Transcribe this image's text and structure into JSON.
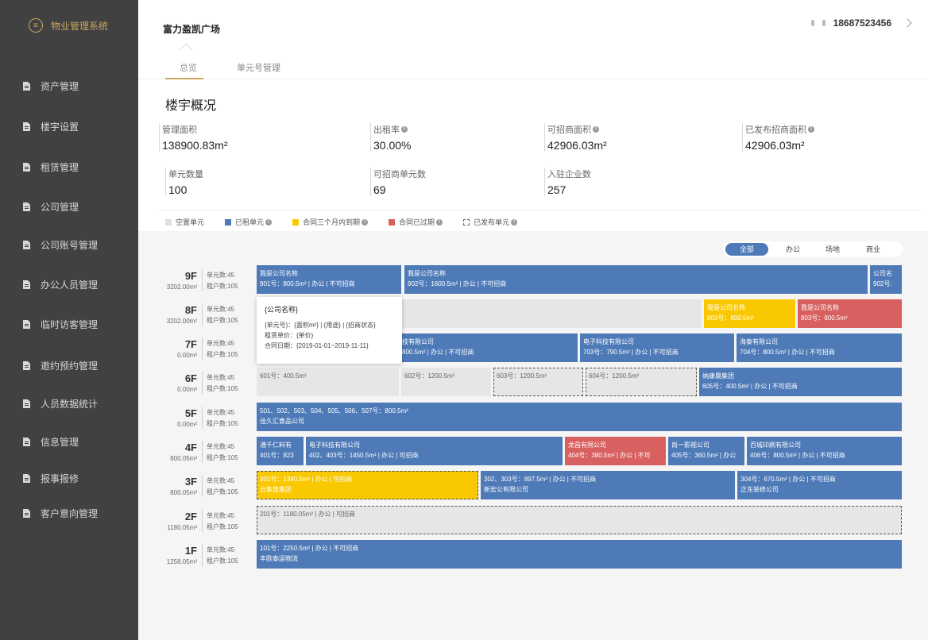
{
  "sidebar": {
    "brand": "物业管理系统",
    "items": [
      {
        "label": "资产管理"
      },
      {
        "label": "楼宇设置"
      },
      {
        "label": "租赁管理"
      },
      {
        "label": "公司管理"
      },
      {
        "label": "公司账号管理"
      },
      {
        "label": "办公人员管理"
      },
      {
        "label": "临时访客管理"
      },
      {
        "label": "邀约预约管理"
      },
      {
        "label": "人员数据统计"
      },
      {
        "label": "信息管理"
      },
      {
        "label": "报事报修"
      },
      {
        "label": "客户意向管理"
      }
    ]
  },
  "header": {
    "title": "富力盈凯广场",
    "tabs": [
      {
        "label": "总览"
      },
      {
        "label": "单元号管理"
      }
    ],
    "phone": "18687523456"
  },
  "overview": {
    "title": "楼宇概况",
    "stats": [
      {
        "label": "管理面积",
        "value": "138900.83m²",
        "info": false
      },
      {
        "label": "出租率",
        "value": "30.00%",
        "info": true
      },
      {
        "label": "可招商面积",
        "value": "42906.03m²",
        "info": true
      },
      {
        "label": "已发布招商面积",
        "value": "42906.03m²",
        "info": true
      },
      {
        "label": "单元数量",
        "value": "100",
        "info": false
      },
      {
        "label": "可招商单元数",
        "value": "69",
        "info": false
      },
      {
        "label": "入驻企业数",
        "value": "257",
        "info": false
      }
    ]
  },
  "legend": [
    {
      "label": "空置单元",
      "color": "#e0e0e0",
      "info": false
    },
    {
      "label": "已租单元",
      "color": "#4e7ab8",
      "info": true
    },
    {
      "label": "合同三个月内到期",
      "color": "#fac800",
      "info": true
    },
    {
      "label": "合同已过期",
      "color": "#d86060",
      "info": true
    },
    {
      "label": "已发布单元",
      "color": "dashed",
      "info": true
    }
  ],
  "filters": [
    {
      "label": "全部",
      "active": true
    },
    {
      "label": "办公",
      "active": false
    },
    {
      "label": "场地",
      "active": false
    },
    {
      "label": "商业",
      "active": false
    }
  ],
  "floors": [
    {
      "floor": "9F",
      "area": "3202.00m²",
      "units": "单元数:45",
      "tenants": "租户数:105"
    },
    {
      "floor": "8F",
      "area": "3202.00m²",
      "units": "单元数:45",
      "tenants": "租户数:105"
    },
    {
      "floor": "7F",
      "area": "0.00m²",
      "units": "单元数:45",
      "tenants": "租户数:105"
    },
    {
      "floor": "6F",
      "area": "0.00m²",
      "units": "单元数:45",
      "tenants": "租户数:105"
    },
    {
      "floor": "5F",
      "area": "0.00m²",
      "units": "单元数:45",
      "tenants": "租户数:105"
    },
    {
      "floor": "4F",
      "area": "800.05m²",
      "units": "单元数:45",
      "tenants": "租户数:105"
    },
    {
      "floor": "3F",
      "area": "800.05m²",
      "units": "单元数:45",
      "tenants": "租户数:105"
    },
    {
      "floor": "2F",
      "area": "1180.05m²",
      "units": "单元数:45",
      "tenants": "租户数:105"
    },
    {
      "floor": "1F",
      "area": "1258.05m²",
      "units": "单元数:45",
      "tenants": "租户数:105"
    }
  ],
  "units": {
    "u901": {
      "l1": "我是公司名称",
      "l2": "901号：800.5m² | 办公 | 不可招商"
    },
    "u902": {
      "l1": "我是公司名称",
      "l2": "902号：1600.5m² | 办公 | 不可招商"
    },
    "u902b": {
      "l1": "公司名",
      "l2": "902号:"
    },
    "u803": {
      "l1": "我是公司名称",
      "l2": "803号：800.5m²"
    },
    "u803b": {
      "l1": "我是公司名称",
      "l2": "803号：800.5m²"
    },
    "u702": {
      "l1": "技有限公司",
      "l2": "800.5m² | 办公 | 不可招商"
    },
    "u703": {
      "l1": "电子科技有限公司",
      "l2": "703号：790.5m² | 办公 | 不可招商"
    },
    "u704": {
      "l1": "海泰有限公司",
      "l2": "704号：800.5m² | 办公 | 不可招商"
    },
    "u601": {
      "l1": "601号：400.5m²"
    },
    "u602": {
      "l1": "602号：1200.5m²"
    },
    "u603": {
      "l1": "603号：1200.5m²"
    },
    "u604": {
      "l1": "604号：1200.5m²"
    },
    "u605": {
      "l1": "纳康晨集团",
      "l2": "605号：400.5m² | 办公 | 不可招商"
    },
    "u5": {
      "l1": "501、502、503、504、505、506、507号：800.5m²",
      "l2": "佳久汇食品公司"
    },
    "u401": {
      "l1": "通千仁料有",
      "l2": "401号：823"
    },
    "u402": {
      "l1": "电子科技有限公司",
      "l2": "402、403号：1450.5m² | 办公 | 可招商"
    },
    "u404": {
      "l1": "龙昌有限公司",
      "l2": "404号：380.5m² | 办公 | 不可"
    },
    "u405": {
      "l1": "尚一影视公司",
      "l2": "405号：360.5m² | 办公"
    },
    "u406": {
      "l1": "百城印刷有限公司",
      "l2": "406号：800.5m² | 办公 | 不可招商"
    },
    "u301": {
      "l1": "301号：1390.5m² | 办公 | 可招商",
      "l2": "云集旅集团"
    },
    "u302": {
      "l1": "302、303号：897.5m² | 办公 | 不可招商",
      "l2": "新宏公有限公司"
    },
    "u304": {
      "l1": "304号：670.5m² | 办公 | 不可招商",
      "l2": "正东装修公司"
    },
    "u201": {
      "l1": "201号：1180.05m² | 办公 | 可招商"
    },
    "u101": {
      "l1": "101号：2250.5m² | 办公 | 不可招商",
      "l2": "丰欧泰运物流"
    }
  },
  "tooltip": {
    "title": "{公司名称}",
    "line1": "{单元号}：{面积m²} | {用途} | {招商状态}",
    "line2": "租赁单价：{单价}",
    "line3": "合同日期：{2019-01-01~2019-11-11}"
  }
}
